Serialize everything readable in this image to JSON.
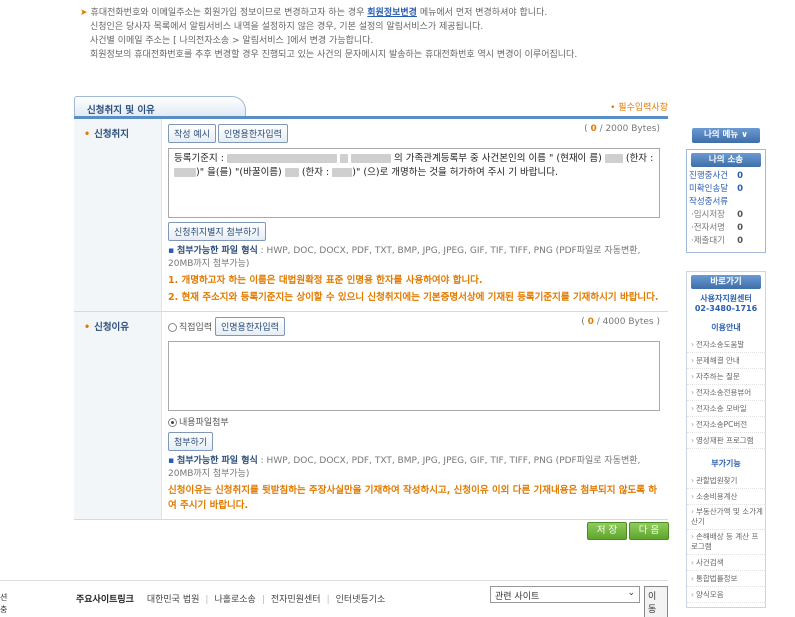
{
  "notice": {
    "line1_pre": "휴대전화번호와 이메일주소는 회원가입 정보이므로 변경하고자 하는 경우",
    "line1_link": "회원정보변경",
    "line1_post": "메뉴에서 먼저 변경하셔야 합니다.",
    "line2": "신청인은 당사자 목록에서 알림서비스 내역을 설정하지 않은 경우, 기본 설정의 알림서비스가 제공됩니다.",
    "line3": "사건별 이메일 주소는 [ 나의전자소송 > 알림서비스 ]에서 변경 가능합니다.",
    "line4": "회원정보의 휴대전화번호를 추후 변경할 경우 진행되고 있는 사건의 문자메시지 발송하는 휴대전화번호 역시 변경이 이루어집니다."
  },
  "section": {
    "tab_title": "신청취지 및 이유",
    "required_note": "• 필수입력사항"
  },
  "purpose": {
    "label": "신청취지",
    "btn_example": "작성 예시",
    "btn_hanja": "인명용한자입력",
    "bytes_open": "( ",
    "bytes_count": "0",
    "bytes_rest": " / 2000 Bytes)",
    "text_a": "등록기준지 :",
    "text_b": "의 가족관계등록부 중 사건본인의 이름 \" (현재이",
    "text_c": "름)",
    "text_d": "(한자 :",
    "text_e": ")\" 을(를) \"(바꿀이름)",
    "text_f": "(한자 :",
    "text_g": ")\" (으)로 개명하는 것을 허가하여 주시",
    "text_h": "기 바랍니다.",
    "btn_attach": "신청취지별지 첨부하기",
    "info_bullet": "▪",
    "info_label": "첨부가능한 파일 형식",
    "info_text": ": HWP, DOC, DOCX, PDF, TXT, BMP, JPG, JPEG, GIF, TIF, TIFF, PNG (PDF파일로 자동변환, 20MB까지 첨부가능)",
    "warn1": "1. 개명하고자 하는 이름은 대법원확정 표준 인명용 한자를 사용하여야 합니다.",
    "warn2": "2. 현재 주소지와 등록기준지는 상이할 수 있으니 신청취지에는 기본증명서상에 기재된 등록기준지를 기재하시기 바랍니다."
  },
  "reason": {
    "label": "신청이유",
    "radio_direct": "직접입력",
    "btn_hanja": "인명용한자입력",
    "bytes_open": "( ",
    "bytes_count": "0",
    "bytes_rest": " / 4000 Bytes )",
    "radio_file": "내용파일첨부",
    "btn_attach": "첨부하기",
    "info_bullet": "▪",
    "info_label": "첨부가능한 파일 형식",
    "info_text": ": HWP, DOC, DOCX, PDF, TXT, BMP, JPG, JPEG, GIF, TIF, TIFF, PNG (PDF파일로 자동변환, 20MB까지 첨부가능)",
    "warn": "신청이유는 신청취지를 뒷받침하는 주장사실만을 기재하여 작성하시고, 신청이유 이외 다른 기재내용은 첨부되지 않도록 하여 주시기 바랍니다."
  },
  "actions": {
    "save": "저 장",
    "next": "다 음"
  },
  "footer": {
    "label": "주요사이트링크",
    "link1": "대한민국 법원",
    "link2": "나홀로소송",
    "link3": "전자민원센터",
    "link4": "인터넷등기소",
    "select_value": "관련 사이트",
    "go": "이동",
    "edge1": "션",
    "edge2": "충"
  },
  "sidebar": {
    "my_menu": "나의 메뉴 ∨",
    "my_lawsuit": "나의 소송",
    "ongoing": "진행중사건",
    "ongoing_v": "0",
    "unsent": "미확인송달",
    "unsent_v": "0",
    "drafts_title": "작성중서류",
    "temp": "·임시저장",
    "temp_v": "0",
    "esign": "·전자서명",
    "esign_v": "0",
    "submit_wait": "·제출대기",
    "submit_wait_v": "0",
    "shortcut": "바로가기",
    "center": "사용자지원센터",
    "phone": "02-3480-1716",
    "guide_title": "이용안내",
    "guide": [
      "전자소송도움말",
      "문제해결 안내",
      "자주하는 질문",
      "전자소송전용뷰어",
      "전자소송 모바일",
      "전자소송PC버전",
      "영상재판 프로그램"
    ],
    "extra_title": "부가기능",
    "extra": [
      "관할법원찾기",
      "소송비용계산",
      "부동산가액 및 소가계산기",
      "손해배상 등 계산 프로그램",
      "사건검색",
      "통합법률정보",
      "양식모음"
    ]
  }
}
